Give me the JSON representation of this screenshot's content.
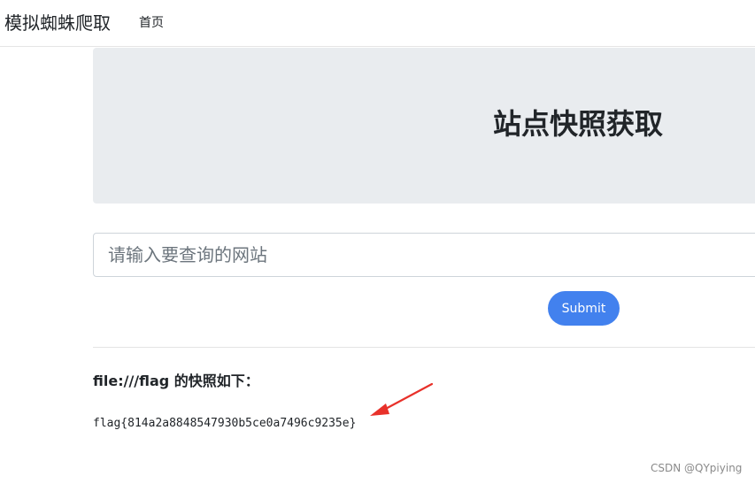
{
  "navbar": {
    "brand": "模拟蜘蛛爬取",
    "links": [
      {
        "label": "首页"
      }
    ]
  },
  "jumbotron": {
    "title": "站点快照获取"
  },
  "search": {
    "placeholder": "请输入要查询的网站",
    "value": ""
  },
  "submit": {
    "label": "Submit"
  },
  "result": {
    "heading": "file:///flag 的快照如下：",
    "content": "flag{814a2a8848547930b5ce0a7496c9235e}"
  },
  "watermark": "CSDN @QYpiying",
  "colors": {
    "accent": "#4281ee",
    "jumbotron_bg": "#e9ecef",
    "annotation_arrow": "#e8312a"
  }
}
